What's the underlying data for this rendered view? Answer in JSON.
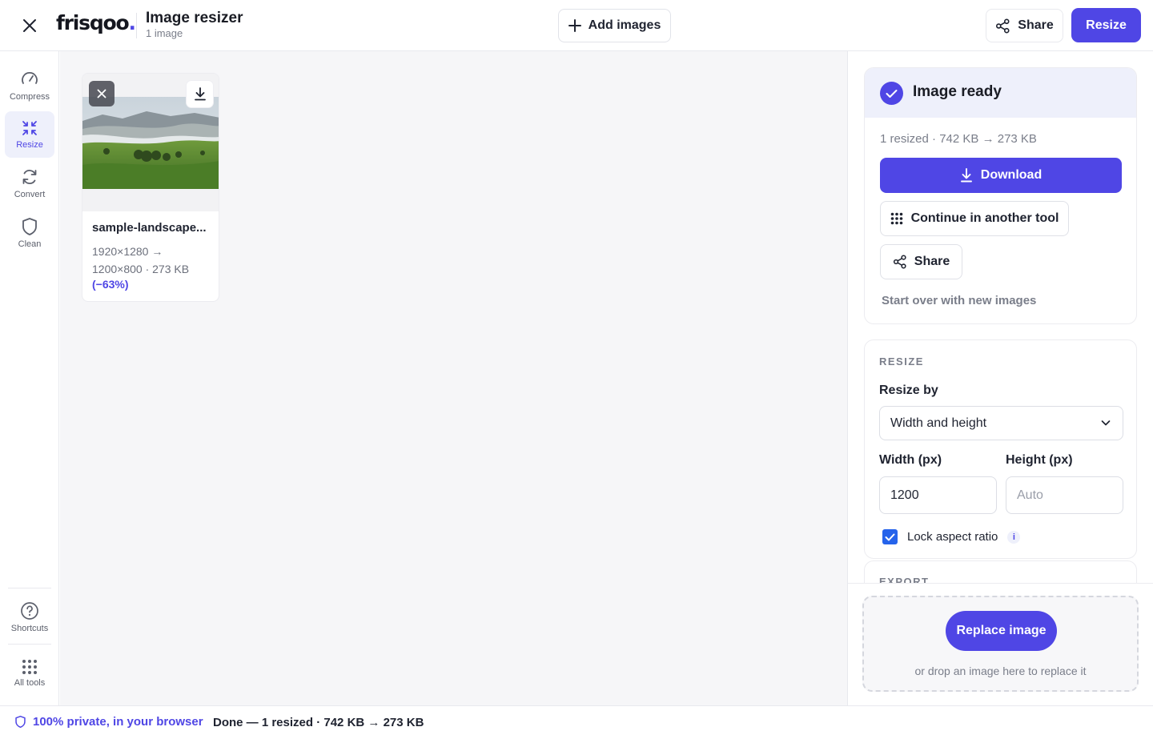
{
  "header": {
    "logo_text": "frisqoo",
    "logo_dot": ".",
    "app_title": "Image resizer",
    "app_subtitle": "1 image",
    "add_images_label": "Add images",
    "share_label": "Share",
    "resize_label": "Resize"
  },
  "sidebar": {
    "items": [
      {
        "label": "Compress",
        "icon": "gauge-icon"
      },
      {
        "label": "Resize",
        "icon": "arrows-in-icon",
        "active": true
      },
      {
        "label": "Convert",
        "icon": "refresh-icon"
      },
      {
        "label": "Clean",
        "icon": "shield-icon"
      }
    ],
    "bottom": [
      {
        "label": "Shortcuts",
        "icon": "question-icon"
      },
      {
        "label": "All tools",
        "icon": "grid-icon"
      }
    ]
  },
  "image_card": {
    "filename": "sample-landscape...",
    "dims_line1": "1920×1280 →",
    "dims_line2": "1200×800 · 273 KB",
    "reduction": "(−63%)"
  },
  "result": {
    "title": "Image ready",
    "stats": "1 resized · 742 KB → 273 KB",
    "download_label": "Download",
    "continue_label": "Continue in another tool",
    "share_label": "Share",
    "start_over_label": "Start over with new images"
  },
  "resize_settings": {
    "section_label": "RESIZE",
    "resize_by_label": "Resize by",
    "resize_by_value": "Width and height",
    "width_label": "Width (px)",
    "height_label": "Height (px)",
    "width_value": "1200",
    "height_placeholder": "Auto",
    "lock_label": "Lock aspect ratio",
    "lock_checked": true,
    "info_glyph": "i"
  },
  "export": {
    "section_label": "EXPORT"
  },
  "dropzone": {
    "button_label": "Replace image",
    "hint": "or drop an image here to replace it"
  },
  "status": {
    "privacy": "100% private, in your browser",
    "message": "Done — 1 resized · 742 KB → 273 KB"
  },
  "colors": {
    "accent": "#4f46e5",
    "checkbox": "#2563eb",
    "highlight_bg": "#eef0fb"
  }
}
